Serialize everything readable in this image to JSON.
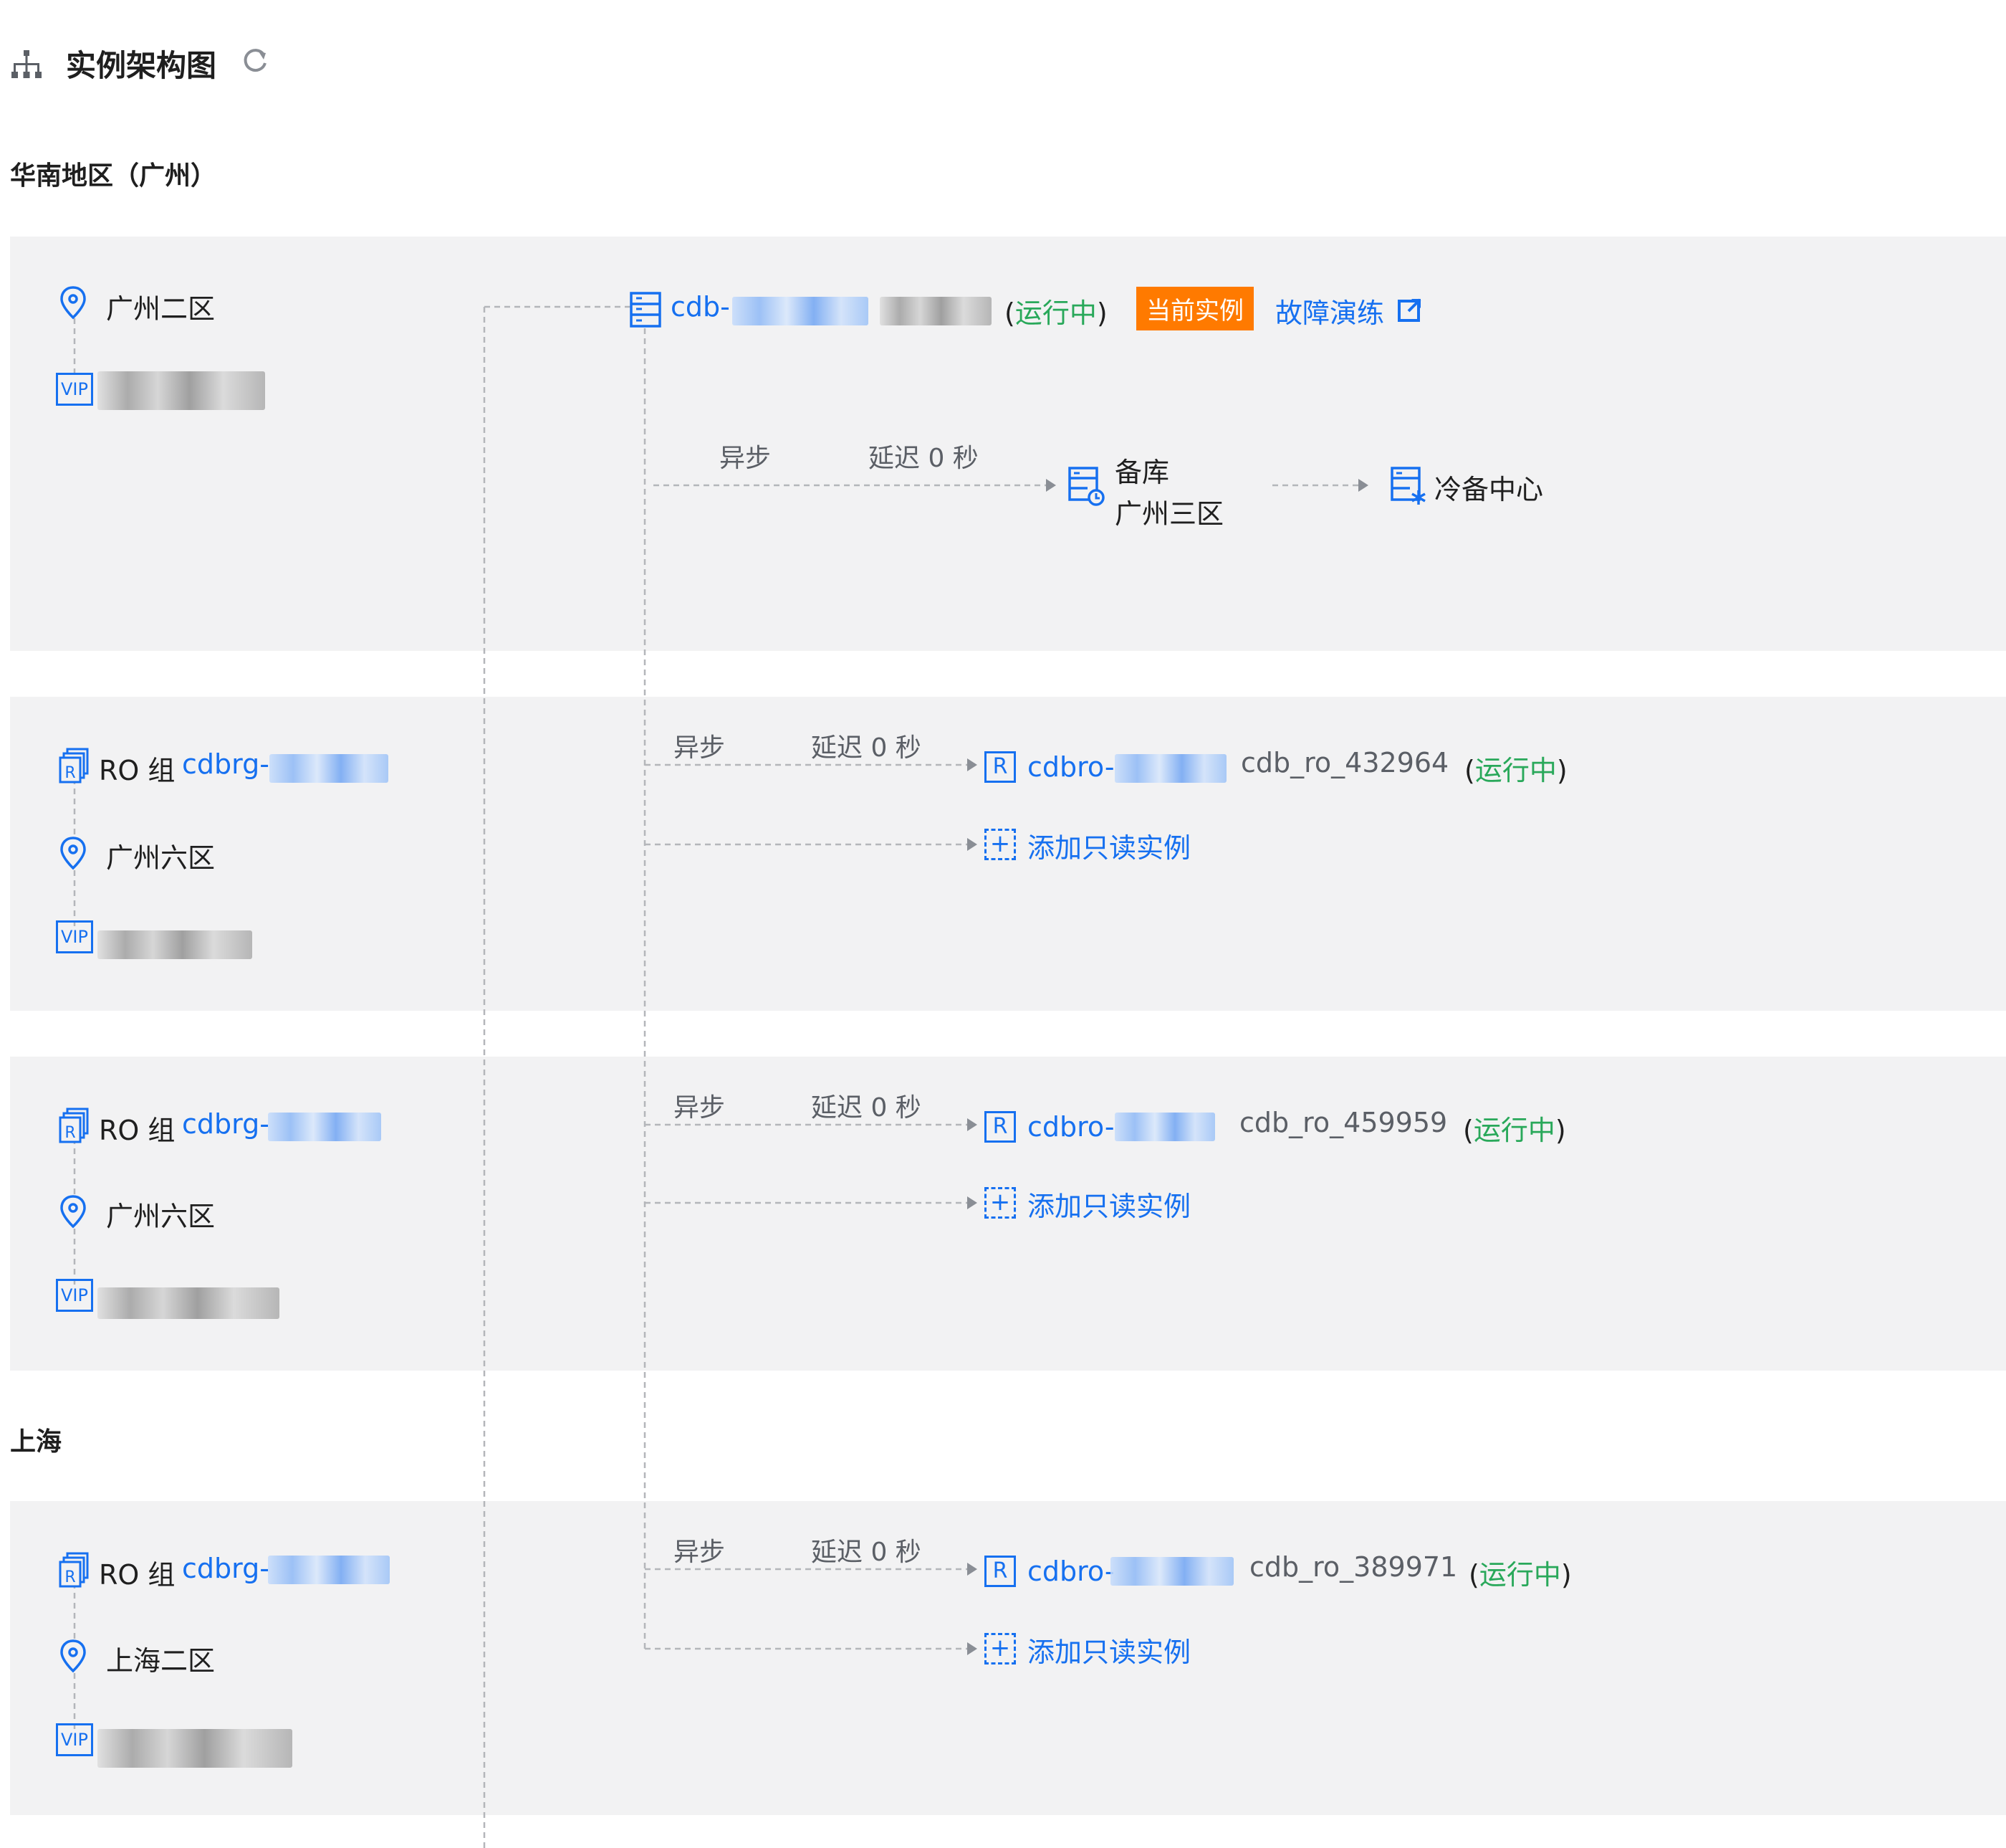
{
  "header": {
    "title": "实例架构图"
  },
  "regions": [
    {
      "name": "华南地区（广州）"
    },
    {
      "name": "上海"
    }
  ],
  "primary": {
    "zone": "广州二区",
    "vip_label": "VIP",
    "instance_prefix": "cdb-",
    "status": "运行中",
    "current_badge": "当前实例",
    "drill_link": "故障演练",
    "sync_mode": "异步",
    "delay": "延迟 0 秒",
    "standby_title": "备库",
    "standby_zone": "广州三区",
    "cold_backup": "冷备中心"
  },
  "ro_groups": [
    {
      "label": "RO 组",
      "id_prefix": "cdbrg-",
      "zone": "广州六区",
      "vip_label": "VIP",
      "sync_mode": "异步",
      "delay": "延迟 0 秒",
      "r_icon": "R",
      "instance_prefix": "cdbro-",
      "instance_name": "cdb_ro_432964",
      "status": "运行中",
      "add_label": "添加只读实例"
    },
    {
      "label": "RO 组",
      "id_prefix": "cdbrg-",
      "zone": "广州六区",
      "vip_label": "VIP",
      "sync_mode": "异步",
      "delay": "延迟 0 秒",
      "r_icon": "R",
      "instance_prefix": "cdbro-",
      "instance_name": "cdb_ro_459959",
      "status": "运行中",
      "add_label": "添加只读实例"
    },
    {
      "label": "RO 组",
      "id_prefix": "cdbrg-",
      "zone": "上海二区",
      "vip_label": "VIP",
      "sync_mode": "异步",
      "delay": "延迟 0 秒",
      "r_icon": "R",
      "instance_prefix": "cdbro-",
      "instance_name": "cdb_ro_389971",
      "status": "运行中",
      "add_label": "添加只读实例"
    }
  ],
  "icons": [
    "topology-icon",
    "refresh-icon",
    "location-pin-icon",
    "vip-icon",
    "database-icon",
    "external-link-icon",
    "standby-db-icon",
    "cold-backup-icon",
    "ro-group-icon",
    "readonly-r-icon",
    "add-plus-icon"
  ],
  "colors": {
    "blue": "#1670f0",
    "green": "#29a85a",
    "orange": "#ff7a00",
    "panel": "#f2f2f3"
  }
}
